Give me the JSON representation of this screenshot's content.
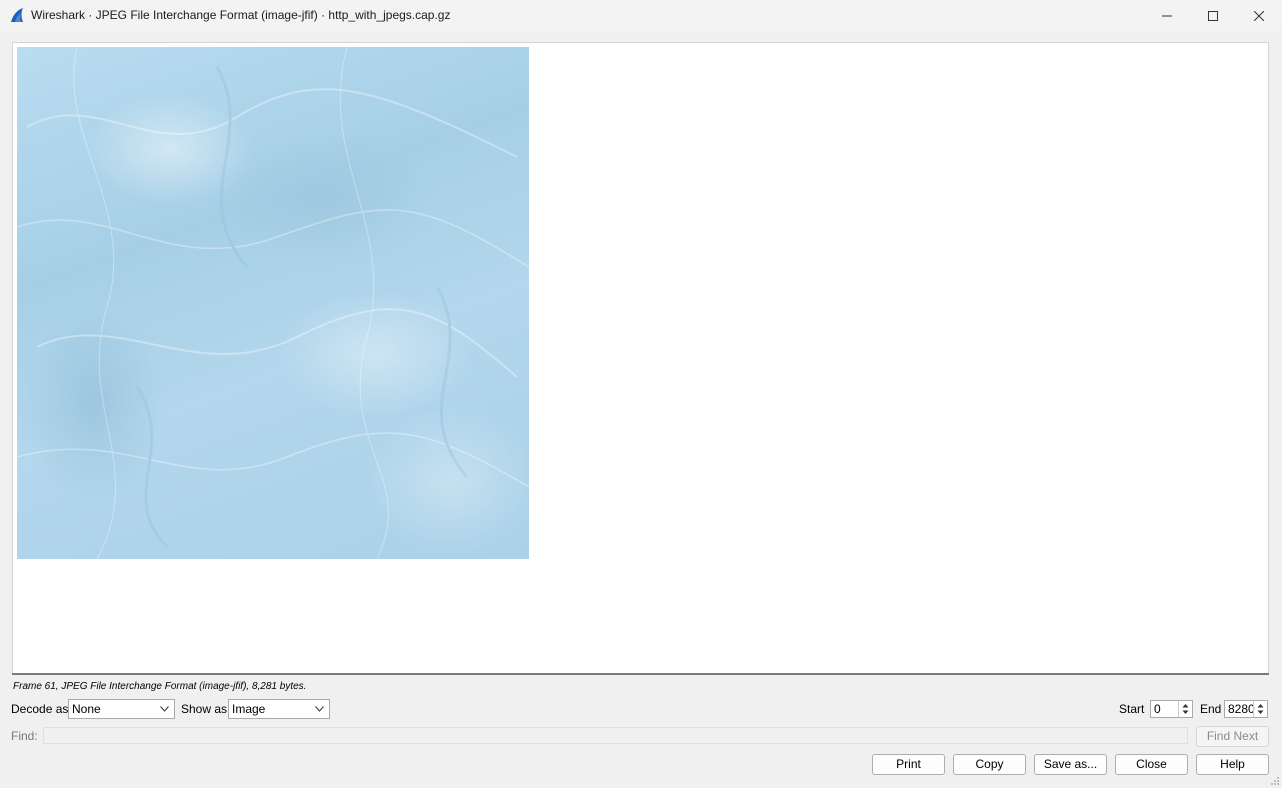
{
  "window": {
    "title": "Wireshark · JPEG File Interchange Format (image-jfif) · http_with_jpegs.cap.gz",
    "icon": "wireshark-fin-icon",
    "controls": [
      "minimize-icon",
      "maximize-icon",
      "close-icon"
    ]
  },
  "status": {
    "text": "Frame 61, JPEG File Interchange Format (image-jfif), 8,281 bytes."
  },
  "decode": {
    "label": "Decode as",
    "value": "None"
  },
  "show": {
    "label": "Show as",
    "value": "Image"
  },
  "range": {
    "start_label": "Start",
    "start_value": "0",
    "end_label": "End",
    "end_value": "8280"
  },
  "find": {
    "label": "Find:",
    "value": "",
    "next_label": "Find Next"
  },
  "buttons": {
    "print": "Print",
    "copy": "Copy",
    "save_as": "Save as...",
    "close": "Close",
    "help": "Help"
  },
  "colors": {
    "accent": "#1d5fbf",
    "image_tint": "#a9d1e8"
  }
}
